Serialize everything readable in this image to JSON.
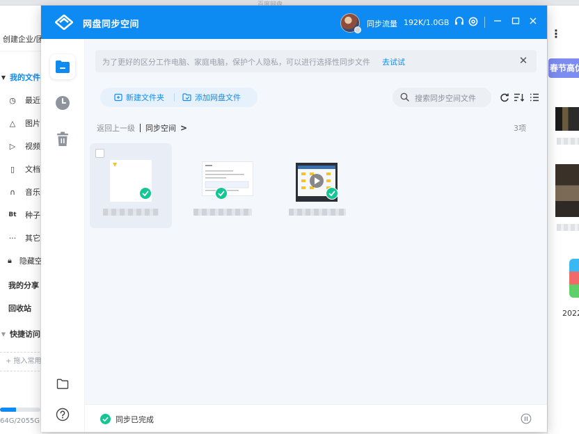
{
  "background": {
    "window_title": "百度网盘",
    "create_label": "创建企业/团队",
    "nav": [
      {
        "label": "我的文件",
        "icon": "caret-down-icon",
        "active": true
      },
      {
        "label": "最近",
        "icon": "clock-icon"
      },
      {
        "label": "图片",
        "icon": "mountain-icon"
      },
      {
        "label": "视频",
        "icon": "play-icon"
      },
      {
        "label": "文档",
        "icon": "doc-icon"
      },
      {
        "label": "音乐",
        "icon": "headphones-icon"
      },
      {
        "label": "种子",
        "icon": "bt-icon"
      },
      {
        "label": "其它",
        "icon": "more-icon"
      },
      {
        "label": "隐藏空间",
        "icon": "lock-icon"
      }
    ],
    "groups": {
      "share": "我的分享",
      "trash": "回收站",
      "quick": "快捷访问"
    },
    "pin_label": "+ 拖入常用文件夹",
    "quota_text": "64G/2055G",
    "quota_fraction": 0.03,
    "promo": "春节高优",
    "year_label": "2022"
  },
  "window": {
    "title": "网盘同步空间",
    "traffic_label": "同步流量",
    "traffic_value": "192K/1.0GB",
    "banner_text": "为了更好的区分工作电脑、家庭电脑，保护个人隐私，可以进行选择性同步文件",
    "banner_link": "去试试",
    "new_folder": "新建文件夹",
    "add_files": "添加网盘文件",
    "search_placeholder": "搜索同步空间文件",
    "breadcrumb_back": "返回上一级",
    "breadcrumb_current": "同步空间",
    "item_count": "3项",
    "status_text": "同步已完成"
  },
  "colors": {
    "brand": "#0d8bf2",
    "success": "#14c596"
  }
}
